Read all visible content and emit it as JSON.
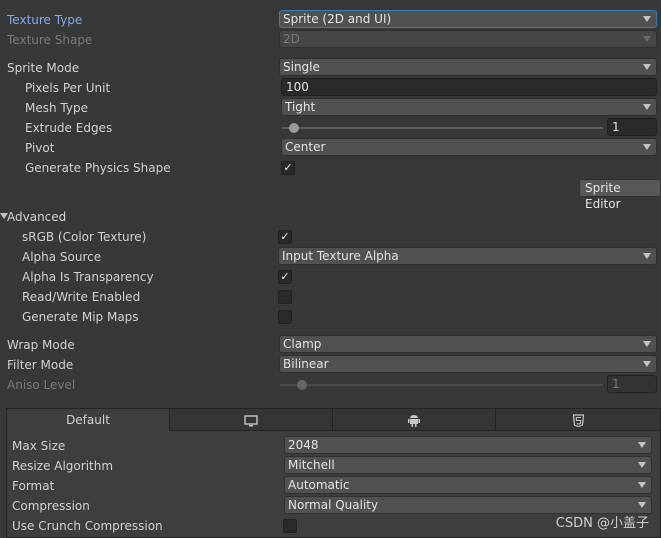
{
  "general": {
    "texture_type": {
      "label": "Texture Type",
      "value": "Sprite (2D and UI)"
    },
    "texture_shape": {
      "label": "Texture Shape",
      "value": "2D"
    },
    "sprite_mode": {
      "label": "Sprite Mode",
      "value": "Single"
    },
    "pixels_per_unit": {
      "label": "Pixels Per Unit",
      "value": "100"
    },
    "mesh_type": {
      "label": "Mesh Type",
      "value": "Tight"
    },
    "extrude_edges": {
      "label": "Extrude Edges",
      "value": "1"
    },
    "pivot": {
      "label": "Pivot",
      "value": "Center"
    },
    "generate_physics_shape": {
      "label": "Generate Physics Shape",
      "checked": true
    },
    "sprite_editor_button": "Sprite Editor"
  },
  "advanced": {
    "title": "Advanced",
    "srgb": {
      "label": "sRGB (Color Texture)",
      "checked": true
    },
    "alpha_source": {
      "label": "Alpha Source",
      "value": "Input Texture Alpha"
    },
    "alpha_is_transparency": {
      "label": "Alpha Is Transparency",
      "checked": true
    },
    "read_write": {
      "label": "Read/Write Enabled",
      "checked": false
    },
    "mip_maps": {
      "label": "Generate Mip Maps",
      "checked": false
    }
  },
  "sampling": {
    "wrap_mode": {
      "label": "Wrap Mode",
      "value": "Clamp"
    },
    "filter_mode": {
      "label": "Filter Mode",
      "value": "Bilinear"
    },
    "aniso_level": {
      "label": "Aniso Level",
      "value": "1"
    }
  },
  "platform": {
    "tabs": [
      {
        "label": "Default",
        "icon": ""
      },
      {
        "label": "",
        "icon": "monitor-icon"
      },
      {
        "label": "",
        "icon": "android-icon"
      },
      {
        "label": "",
        "icon": "html5-icon"
      }
    ],
    "max_size": {
      "label": "Max Size",
      "value": "2048"
    },
    "resize_algorithm": {
      "label": "Resize Algorithm",
      "value": "Mitchell"
    },
    "format": {
      "label": "Format",
      "value": "Automatic"
    },
    "compression": {
      "label": "Compression",
      "value": "Normal Quality"
    },
    "crunch": {
      "label": "Use Crunch Compression",
      "checked": false
    }
  },
  "watermark": "CSDN @小盖子",
  "colors": {
    "accent": "#7babf2",
    "background": "#383838"
  }
}
